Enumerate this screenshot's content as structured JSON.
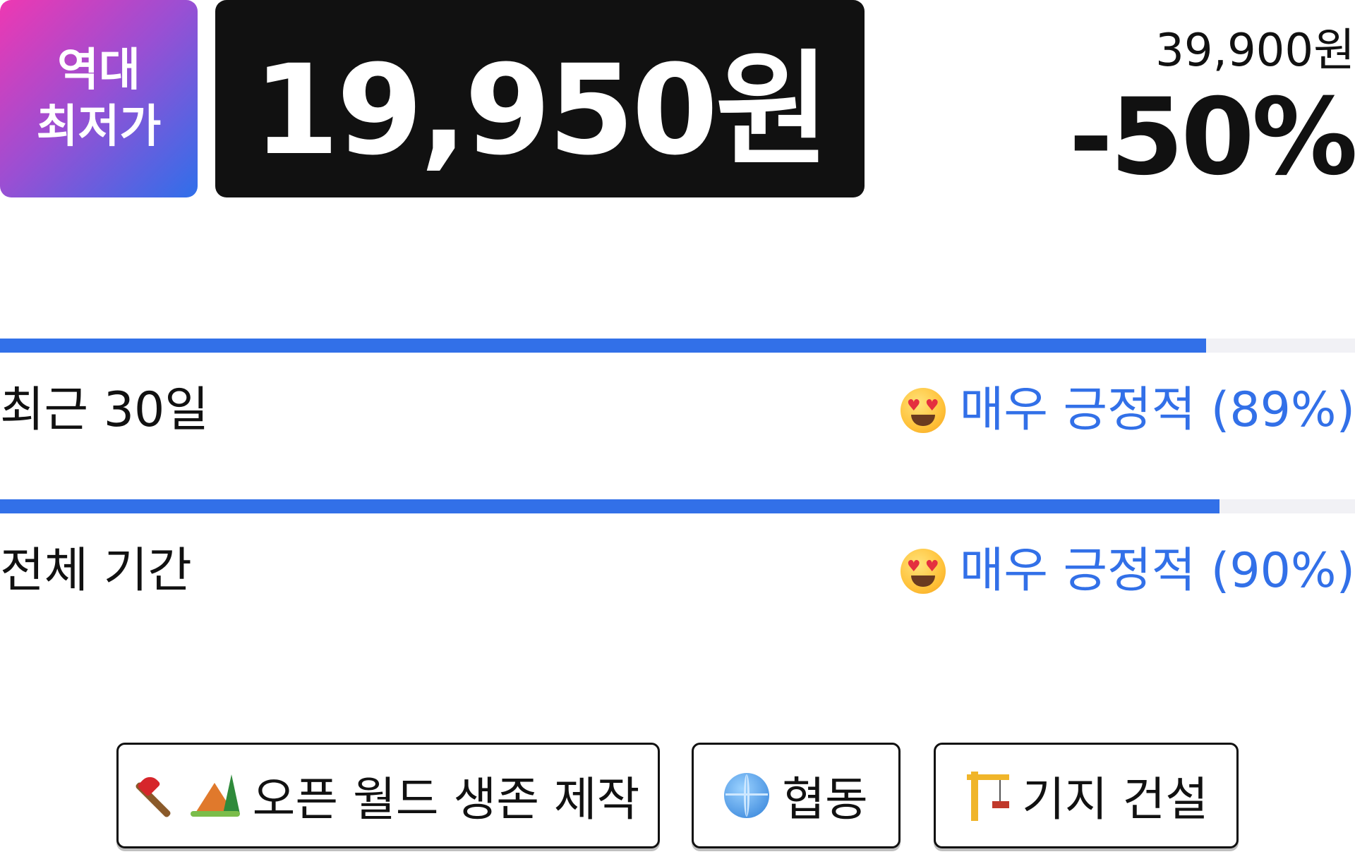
{
  "badge": {
    "line1": "역대",
    "line2": "최저가"
  },
  "price": {
    "current": "19,950원",
    "original": "39,900원",
    "discount": "-50%"
  },
  "reviews": [
    {
      "period": "최근 30일",
      "rating": "매우 긍정적 (89%)",
      "bar_fraction": 0.89
    },
    {
      "period": "전체 기간",
      "rating": "매우 긍정적 (90%)",
      "bar_fraction": 0.9
    }
  ],
  "tags": [
    {
      "label": "오픈 월드 생존 제작",
      "icons": [
        "axe-icon",
        "camping-icon"
      ]
    },
    {
      "label": "협동",
      "icons": [
        "globe-icon"
      ]
    },
    {
      "label": "기지 건설",
      "icons": [
        "crane-icon"
      ]
    }
  ],
  "colors": {
    "accent": "#3270e8",
    "price_bg": "#111111",
    "badge_gradient": [
      "#ee38b2",
      "#2f6fea"
    ]
  }
}
